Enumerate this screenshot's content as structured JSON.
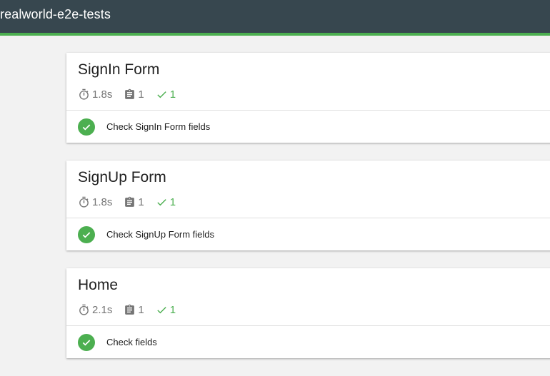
{
  "app": {
    "title": "realworld-e2e-tests"
  },
  "colors": {
    "header_bg": "#37474f",
    "accent": "#4caf50",
    "muted_text": "#757575"
  },
  "suites": [
    {
      "title": "SignIn Form",
      "duration": "1.8s",
      "total": "1",
      "passed": "1",
      "tests": [
        {
          "name": "Check SignIn Form fields",
          "status": "passed"
        }
      ]
    },
    {
      "title": "SignUp Form",
      "duration": "1.8s",
      "total": "1",
      "passed": "1",
      "tests": [
        {
          "name": "Check SignUp Form fields",
          "status": "passed"
        }
      ]
    },
    {
      "title": "Home",
      "duration": "2.1s",
      "total": "1",
      "passed": "1",
      "tests": [
        {
          "name": "Check fields",
          "status": "passed"
        }
      ]
    }
  ],
  "icons": {
    "duration": "timer-icon",
    "total": "clipboard-icon",
    "passed": "check-icon",
    "test_status": "check-circle-icon"
  }
}
